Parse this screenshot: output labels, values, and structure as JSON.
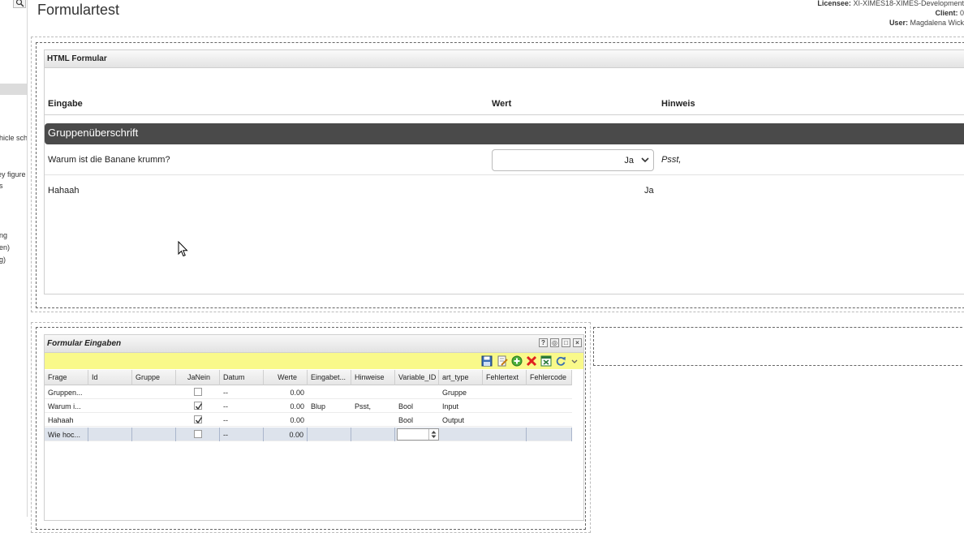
{
  "header": {
    "title": "Formulartest",
    "licensee_label": "Licensee:",
    "licensee_value": "XI-XIMES18-XIMES-Development",
    "client_label": "Client:",
    "client_value": "0",
    "user_label": "User:",
    "user_value": "Magdalena Wick"
  },
  "sidebar": {
    "items": [
      "hicle sch",
      "ey figure",
      "s",
      "ng",
      "en)",
      "g)"
    ]
  },
  "html_form": {
    "panel_title": "HTML Formular",
    "columns": {
      "eingabe": "Eingabe",
      "wert": "Wert",
      "hinweis": "Hinweis"
    },
    "group_title": "Gruppenüberschrift",
    "rows": [
      {
        "question": "Warum ist die Banane krumm?",
        "value": "Ja",
        "hint": "Psst,"
      },
      {
        "question": "Hahaah",
        "value": "Ja"
      }
    ]
  },
  "grid": {
    "panel_title": "Formular Eingaben",
    "title_controls": [
      "?",
      "◎",
      "□",
      "×"
    ],
    "toolbar_icons": [
      "save-icon",
      "edit-icon",
      "add-icon",
      "delete-icon",
      "export-icon",
      "refresh-icon",
      "dropdown-icon"
    ],
    "columns": [
      "Frage",
      "Id",
      "Gruppe",
      "JaNein",
      "Datum",
      "Werte",
      "Eingabet...",
      "Hinweise",
      "Variable_ID",
      "art_type",
      "Fehlertext",
      "Fehlercode"
    ],
    "rows": [
      {
        "frage": "Gruppen...",
        "id": "",
        "gruppe": "",
        "janein": false,
        "datum": "--",
        "werte": "0.00",
        "eingabetyp": "",
        "hinweise": "",
        "variable_id": "",
        "art_type": "Gruppe",
        "fehlertext": "",
        "fehlercode": ""
      },
      {
        "frage": "Warum i...",
        "id": "",
        "gruppe": "",
        "janein": true,
        "datum": "--",
        "werte": "0.00",
        "eingabetyp": "Blup",
        "hinweise": "Psst,",
        "variable_id": "Bool",
        "art_type": "Input",
        "fehlertext": "",
        "fehlercode": ""
      },
      {
        "frage": "Hahaah",
        "id": "",
        "gruppe": "",
        "janein": true,
        "datum": "--",
        "werte": "0.00",
        "eingabetyp": "",
        "hinweise": "",
        "variable_id": "Bool",
        "art_type": "Output",
        "fehlertext": "",
        "fehlercode": ""
      },
      {
        "frage": "Wie hoc...",
        "id": "",
        "gruppe": "",
        "janein": false,
        "datum": "--",
        "werte": "0.00",
        "eingabetyp": "",
        "hinweise": "",
        "variable_id": "",
        "art_type": "",
        "fehlertext": "",
        "fehlercode": ""
      }
    ]
  },
  "colors": {
    "group_bar": "#4a4a4a",
    "toolbar": "#f9f98a",
    "edit_row": "#dde3ec"
  }
}
